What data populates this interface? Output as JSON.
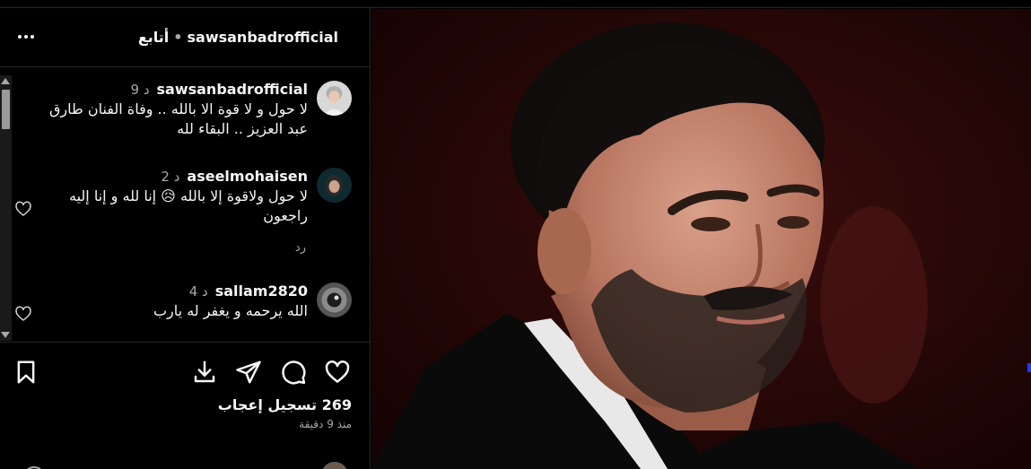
{
  "post": {
    "username": "sawsanbadrofficial",
    "follow_label": "أتابع",
    "separator": "•"
  },
  "comments": [
    {
      "username": "sawsanbadrofficial",
      "time": "9 د",
      "text": "لا حول و لا قوة الا بالله .. وفاة الفنان طارق عبد العزيز .. البقاء لله"
    },
    {
      "username": "aseelmohaisen",
      "time": "2 د",
      "text": "لا حول ولاقوة إلا بالله 😥 إنا لله و إنا إليه راجعون",
      "reply_label": "رد"
    },
    {
      "username": "sallam2820",
      "time": "4 د",
      "text": "الله يرحمه و يغفر له يارب"
    }
  ],
  "actions": {
    "likes": "269 تسجيل إعجاب",
    "time_ago": "منذ 9 دقيقة"
  },
  "colors": {
    "background": "#000000",
    "text": "#f5f5f5",
    "secondary_text": "#a8a8a8",
    "divider": "#262626"
  }
}
